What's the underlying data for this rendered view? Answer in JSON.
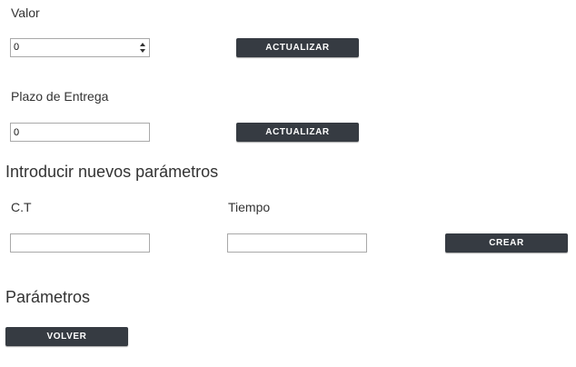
{
  "valor": {
    "label": "Valor",
    "value": "0",
    "button_label": "ACTUALIZAR"
  },
  "plazo": {
    "label": "Plazo de Entrega",
    "value": "0",
    "button_label": "ACTUALIZAR"
  },
  "nuevos": {
    "heading": "Introducir nuevos parámetros",
    "ct_label": "C.T",
    "ct_value": "",
    "tiempo_label": "Tiempo",
    "tiempo_value": "",
    "create_label": "CREAR"
  },
  "parametros": {
    "heading": "Parámetros",
    "back_label": "VOLVER"
  },
  "colors": {
    "button_bg": "#363b42",
    "text": "#333333"
  }
}
